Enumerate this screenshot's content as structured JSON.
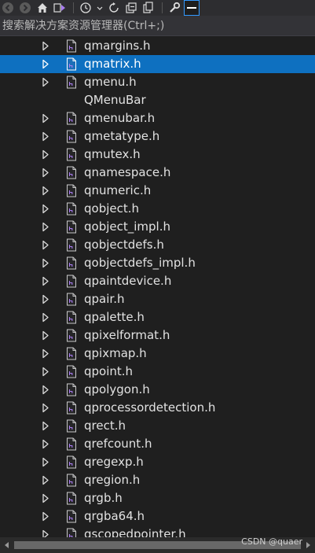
{
  "toolbar": {
    "buttons": [
      {
        "name": "back-icon"
      },
      {
        "name": "forward-icon"
      },
      {
        "name": "home-icon"
      },
      {
        "name": "switch-views-icon"
      },
      {
        "name": "pending-changes-filter-icon"
      },
      {
        "name": "sync-icon"
      },
      {
        "name": "collapse-all-icon"
      },
      {
        "name": "show-all-files-icon"
      },
      {
        "name": "properties-icon"
      },
      {
        "name": "preview-selected-items-icon"
      }
    ]
  },
  "search": {
    "placeholder": "搜索解决方案资源管理器(Ctrl+;)",
    "dropdown_glyph": ""
  },
  "tree": {
    "items": [
      {
        "label": "qmargins.h",
        "expandable": true,
        "selected": false
      },
      {
        "label": "qmatrix.h",
        "expandable": true,
        "selected": true
      },
      {
        "label": "qmenu.h",
        "expandable": true,
        "selected": false
      },
      {
        "label": "QMenuBar",
        "expandable": false,
        "selected": false
      },
      {
        "label": "qmenubar.h",
        "expandable": true,
        "selected": false
      },
      {
        "label": "qmetatype.h",
        "expandable": true,
        "selected": false
      },
      {
        "label": "qmutex.h",
        "expandable": true,
        "selected": false
      },
      {
        "label": "qnamespace.h",
        "expandable": true,
        "selected": false
      },
      {
        "label": "qnumeric.h",
        "expandable": true,
        "selected": false
      },
      {
        "label": "qobject.h",
        "expandable": true,
        "selected": false
      },
      {
        "label": "qobject_impl.h",
        "expandable": true,
        "selected": false
      },
      {
        "label": "qobjectdefs.h",
        "expandable": true,
        "selected": false
      },
      {
        "label": "qobjectdefs_impl.h",
        "expandable": true,
        "selected": false
      },
      {
        "label": "qpaintdevice.h",
        "expandable": true,
        "selected": false
      },
      {
        "label": "qpair.h",
        "expandable": true,
        "selected": false
      },
      {
        "label": "qpalette.h",
        "expandable": true,
        "selected": false
      },
      {
        "label": "qpixelformat.h",
        "expandable": true,
        "selected": false
      },
      {
        "label": "qpixmap.h",
        "expandable": true,
        "selected": false
      },
      {
        "label": "qpoint.h",
        "expandable": true,
        "selected": false
      },
      {
        "label": "qpolygon.h",
        "expandable": true,
        "selected": false
      },
      {
        "label": "qprocessordetection.h",
        "expandable": true,
        "selected": false
      },
      {
        "label": "qrect.h",
        "expandable": true,
        "selected": false
      },
      {
        "label": "qrefcount.h",
        "expandable": true,
        "selected": false
      },
      {
        "label": "qregexp.h",
        "expandable": true,
        "selected": false
      },
      {
        "label": "qregion.h",
        "expandable": true,
        "selected": false
      },
      {
        "label": "qrgb.h",
        "expandable": true,
        "selected": false
      },
      {
        "label": "qrgba64.h",
        "expandable": true,
        "selected": false
      },
      {
        "label": "qscopedpointer.h",
        "expandable": true,
        "selected": false
      }
    ]
  },
  "watermark": "CSDN @quaer",
  "colors": {
    "background": "#1f1f1f",
    "selection": "#0e70c0",
    "text": "#e2e2e2"
  }
}
